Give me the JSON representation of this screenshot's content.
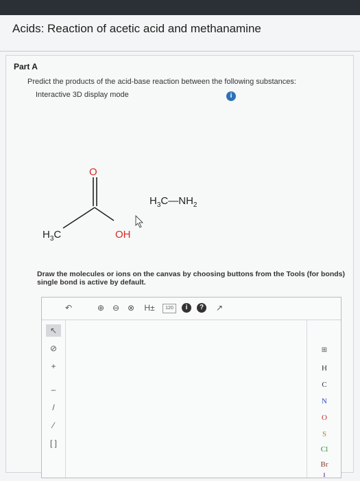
{
  "header": {
    "title": "Acids: Reaction of acetic acid and methanamine"
  },
  "part": {
    "label": "Part A",
    "prompt": "Predict the products of the acid-base reaction between the following substances:",
    "display_mode": "Interactive 3D display mode",
    "info_icon": "i"
  },
  "molecules": {
    "acetic_acid": {
      "oxygen": "O",
      "methyl": "H",
      "methyl_sub": "3",
      "methyl_c": "C",
      "hydroxyl": "OH"
    },
    "methanamine": {
      "h": "H",
      "h_sub": "3",
      "c": "C",
      "dash": "—",
      "n": "NH",
      "n_sub": "2"
    }
  },
  "instructions": {
    "line1": "Draw the molecules or ions on the canvas by choosing buttons from the Tools (for bonds)",
    "line2": "single bond is active by default."
  },
  "editor": {
    "toolbar": {
      "undo": "↶",
      "zoom_in": "⊕",
      "zoom_out": "⊖",
      "reset": "⊗",
      "hydrogens": "H±",
      "charge": "120",
      "info": "i",
      "help": "?",
      "expand": "↗"
    },
    "left_tools": [
      "↖",
      "⊘",
      "+",
      "–",
      "/",
      "⁄",
      "[ ]"
    ],
    "right_tools": {
      "periodic": "⊞",
      "elements": [
        "H",
        "C",
        "N",
        "O",
        "S",
        "Cl",
        "Br",
        "I"
      ],
      "element_colors": [
        "#333333",
        "#333333",
        "#2b4fc2",
        "#c2342b",
        "#b08a1c",
        "#2a8a3a",
        "#8a3a2a",
        "#6a2a8a"
      ]
    }
  },
  "colors": {
    "oxygen": "#d32a22",
    "bond": "#222222",
    "accent": "#2e72b8"
  }
}
